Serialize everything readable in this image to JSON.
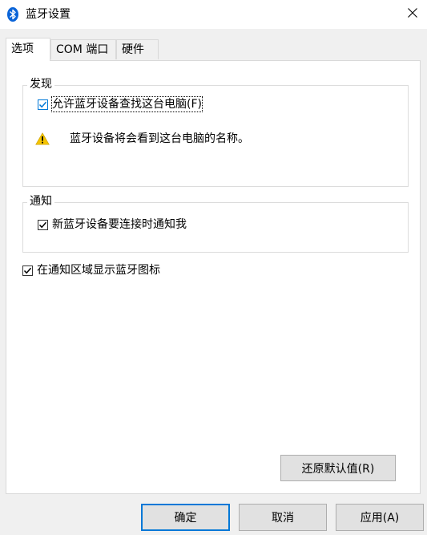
{
  "window": {
    "title": "蓝牙设置"
  },
  "tabs": [
    {
      "label": "选项",
      "active": true
    },
    {
      "label": "COM 端口",
      "active": false
    },
    {
      "label": "硬件",
      "active": false
    }
  ],
  "discovery": {
    "group_label": "发现",
    "allow_discovery": {
      "label": "允许蓝牙设备查找这台电脑(F)",
      "checked": true
    },
    "warning_text": "蓝牙设备将会看到这台电脑的名称。"
  },
  "notifications": {
    "group_label": "通知",
    "notify_new_device": {
      "label": "新蓝牙设备要连接时通知我",
      "checked": true
    }
  },
  "show_tray_icon": {
    "label": "在通知区域显示蓝牙图标",
    "checked": true
  },
  "buttons": {
    "restore_defaults": "还原默认值(R)",
    "ok": "确定",
    "cancel": "取消",
    "apply": "应用(A)"
  },
  "colors": {
    "accent": "#0078d7",
    "bluetooth_icon": "#0a64d8",
    "warning": "#f5c400"
  },
  "icons": [
    "bluetooth-icon",
    "close-icon",
    "warning-icon",
    "checkmark-icon"
  ]
}
